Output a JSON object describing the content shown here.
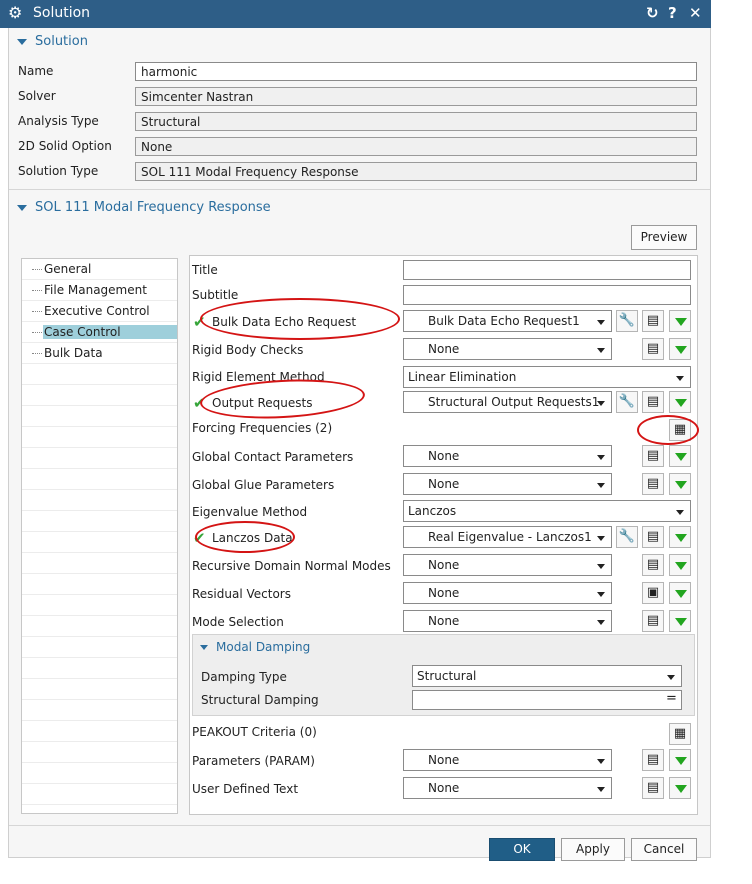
{
  "window": {
    "title": "Solution"
  },
  "solution_section": {
    "header": "Solution",
    "fields": [
      {
        "label": "Name",
        "value": "harmonic"
      },
      {
        "label": "Solver",
        "value": "Simcenter Nastran"
      },
      {
        "label": "Analysis Type",
        "value": "Structural"
      },
      {
        "label": "2D Solid Option",
        "value": "None"
      },
      {
        "label": "Solution Type",
        "value": "SOL 111 Modal Frequency Response"
      }
    ]
  },
  "sol_section": {
    "header": "SOL 111 Modal Frequency Response",
    "preview": "Preview"
  },
  "tree": {
    "items": [
      "General",
      "File Management",
      "Executive Control",
      "Case Control",
      "Bulk Data"
    ],
    "selected": "Case Control"
  },
  "case_control": {
    "title_label": "Title",
    "subtitle_label": "Subtitle",
    "bulk_echo": {
      "label": "Bulk Data Echo Request",
      "value": "Bulk Data Echo Request1"
    },
    "rigid_body": {
      "label": "Rigid Body Checks",
      "value": "None"
    },
    "rigid_element": {
      "label": "Rigid Element Method",
      "value": "Linear Elimination"
    },
    "output_requests": {
      "label": "Output Requests",
      "value": "Structural Output Requests1"
    },
    "forcing_freq": {
      "label": "Forcing Frequencies (2)"
    },
    "global_contact": {
      "label": "Global Contact Parameters",
      "value": "None"
    },
    "global_glue": {
      "label": "Global Glue Parameters",
      "value": "None"
    },
    "eigenvalue": {
      "label": "Eigenvalue Method",
      "value": "Lanczos"
    },
    "lanczos": {
      "label": "Lanczos Data",
      "value": "Real Eigenvalue - Lanczos1"
    },
    "rdmm": {
      "label": "Recursive Domain Normal Modes",
      "value": "None"
    },
    "residual": {
      "label": "Residual Vectors",
      "value": "None"
    },
    "mode_sel": {
      "label": "Mode Selection",
      "value": "None"
    },
    "modal_damping": {
      "header": "Modal Damping",
      "damping_type_label": "Damping Type",
      "damping_type_value": "Structural",
      "structural_damping_label": "Structural Damping",
      "structural_damping_value": ""
    },
    "peakout": {
      "label": "PEAKOUT Criteria (0)"
    },
    "params": {
      "label": "Parameters (PARAM)",
      "value": "None"
    },
    "user_text": {
      "label": "User Defined Text",
      "value": "None"
    }
  },
  "footer": {
    "ok": "OK",
    "apply": "Apply",
    "cancel": "Cancel"
  },
  "colors": {
    "titlebar": "#2e5e87",
    "accent": "#2a6d9e",
    "ok_button": "#205e87",
    "annotation": "#d41414",
    "check": "#37a53a"
  }
}
